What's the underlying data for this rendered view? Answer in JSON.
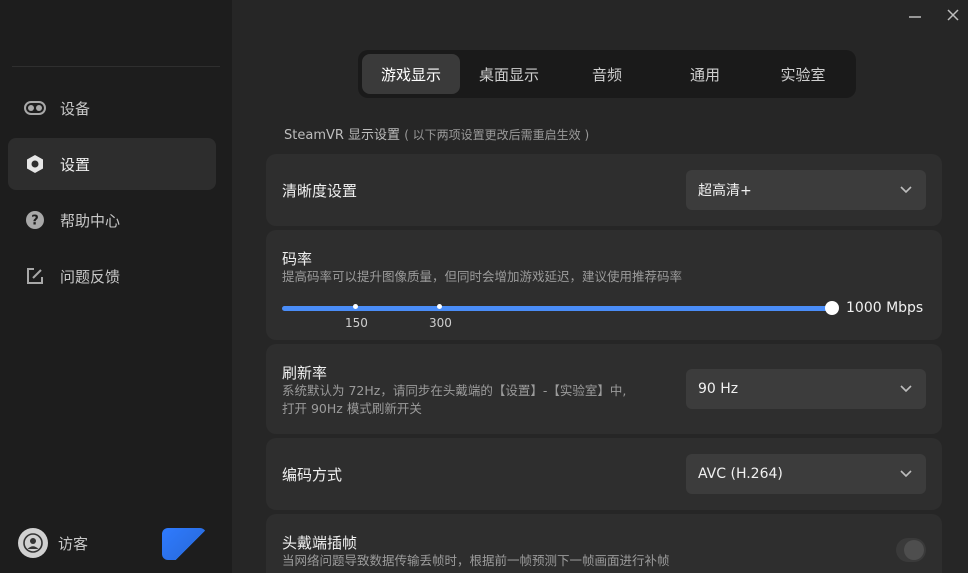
{
  "sidebar": {
    "items": [
      {
        "label": "设备",
        "icon": "vr-headset-icon"
      },
      {
        "label": "设置",
        "icon": "settings-hexagon-icon"
      },
      {
        "label": "帮助中心",
        "icon": "help-icon"
      },
      {
        "label": "问题反馈",
        "icon": "feedback-edit-icon"
      }
    ],
    "active_index": 1,
    "user": {
      "label": "访客",
      "icon": "user-avatar-icon"
    }
  },
  "tabs": [
    {
      "label": "游戏显示"
    },
    {
      "label": "桌面显示"
    },
    {
      "label": "音频"
    },
    {
      "label": "通用"
    },
    {
      "label": "实验室"
    }
  ],
  "active_tab_index": 0,
  "section": {
    "title": "SteamVR 显示设置",
    "note": "( 以下两项设置更改后需重启生效 )"
  },
  "settings": {
    "resolution": {
      "title": "清晰度设置",
      "value": "超高清+"
    },
    "bitrate": {
      "title": "码率",
      "desc": "提高码率可以提升图像质量，但同时会增加游戏延迟，建议使用推荐码率",
      "ticks": [
        "150",
        "300"
      ],
      "value_fraction": 1.0,
      "value_label": "1000 Mbps"
    },
    "refresh": {
      "title": "刷新率",
      "desc_line1": "系统默认为 72Hz，请同步在头戴端的【设置】-【实验室】中,",
      "desc_line2": "打开 90Hz 模式刷新开关",
      "value": "90 Hz"
    },
    "encoding": {
      "title": "编码方式",
      "value": "AVC (H.264)"
    },
    "frame_interp": {
      "title": "头戴端插帧",
      "desc": "当网络问题导致数据传输丢帧时，根据前一帧预测下一帧画面进行补帧",
      "enabled": false
    }
  },
  "colors": {
    "accent": "#4a8df8",
    "sidebar_bg": "#1d1d1d",
    "content_bg": "#262626",
    "card_bg": "#2e2e2e"
  }
}
